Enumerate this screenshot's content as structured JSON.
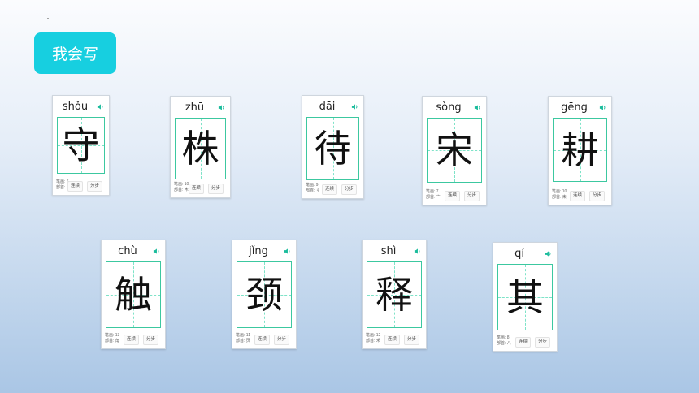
{
  "title": "我会写",
  "labels": {
    "strokes": "笔画:",
    "radical": "部首:",
    "btn_lianxie": "连续",
    "btn_fenbu": "分步"
  },
  "cards": [
    {
      "pinyin": "shǒu",
      "char": "守",
      "strokes": "6",
      "radical": "宀"
    },
    {
      "pinyin": "zhū",
      "char": "株",
      "strokes": "10",
      "radical": "木"
    },
    {
      "pinyin": "dāi",
      "char": "待",
      "strokes": "9",
      "radical": "彳"
    },
    {
      "pinyin": "sòng",
      "char": "宋",
      "strokes": "7",
      "radical": "宀"
    },
    {
      "pinyin": "gēng",
      "char": "耕",
      "strokes": "10",
      "radical": "耒"
    },
    {
      "pinyin": "chù",
      "char": "触",
      "strokes": "13",
      "radical": "角"
    },
    {
      "pinyin": "jǐng",
      "char": "颈",
      "strokes": "11",
      "radical": "页"
    },
    {
      "pinyin": "shì",
      "char": "释",
      "strokes": "12",
      "radical": "釆"
    },
    {
      "pinyin": "qí",
      "char": "其",
      "strokes": "8",
      "radical": "八"
    }
  ],
  "colors": {
    "accent": "#17cfe0",
    "grid": "#3cc8a0",
    "speaker": "#1abc9c"
  }
}
